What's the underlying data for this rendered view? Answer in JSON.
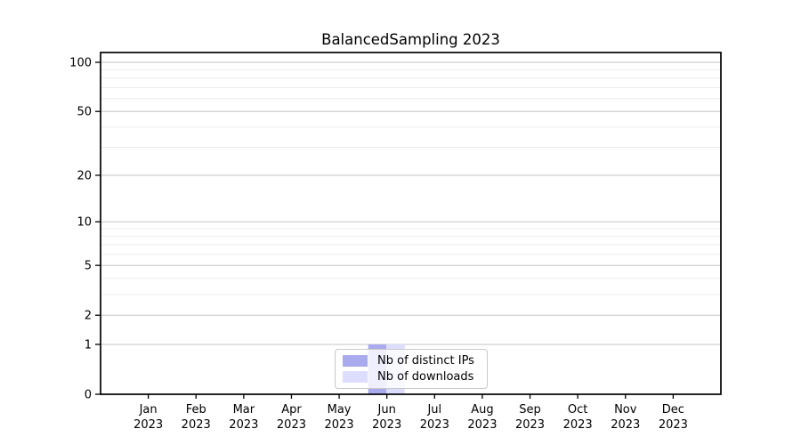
{
  "chart_data": {
    "type": "bar",
    "title": "BalancedSampling 2023",
    "categories": [
      "Jan",
      "Feb",
      "Mar",
      "Apr",
      "May",
      "Jun",
      "Jul",
      "Aug",
      "Sep",
      "Oct",
      "Nov",
      "Dec"
    ],
    "x_year": "2023",
    "series": [
      {
        "name": "Nb of distinct IPs",
        "color": "#aaaaee",
        "values": [
          0,
          0,
          0,
          0,
          0,
          1,
          0,
          0,
          0,
          0,
          0,
          0
        ]
      },
      {
        "name": "Nb of downloads",
        "color": "#ddddff",
        "values": [
          0,
          0,
          0,
          0,
          0,
          1,
          0,
          0,
          0,
          0,
          0,
          0
        ]
      }
    ],
    "xlabel": "",
    "ylabel": "",
    "y_scale": "log10(1+y)",
    "y_major_ticks": [
      0,
      1,
      2,
      5,
      10,
      20,
      50,
      100
    ],
    "y_minor_gridlines": [
      3,
      4,
      6,
      7,
      8,
      9,
      30,
      40,
      60,
      70,
      80,
      90
    ],
    "ylim": [
      0,
      115
    ],
    "grid": true,
    "legend_position": "lower center",
    "colors": {
      "major_grid": "#c6c6c6",
      "minor_grid": "#ececec",
      "axis": "#000000",
      "background": "#ffffff"
    }
  }
}
